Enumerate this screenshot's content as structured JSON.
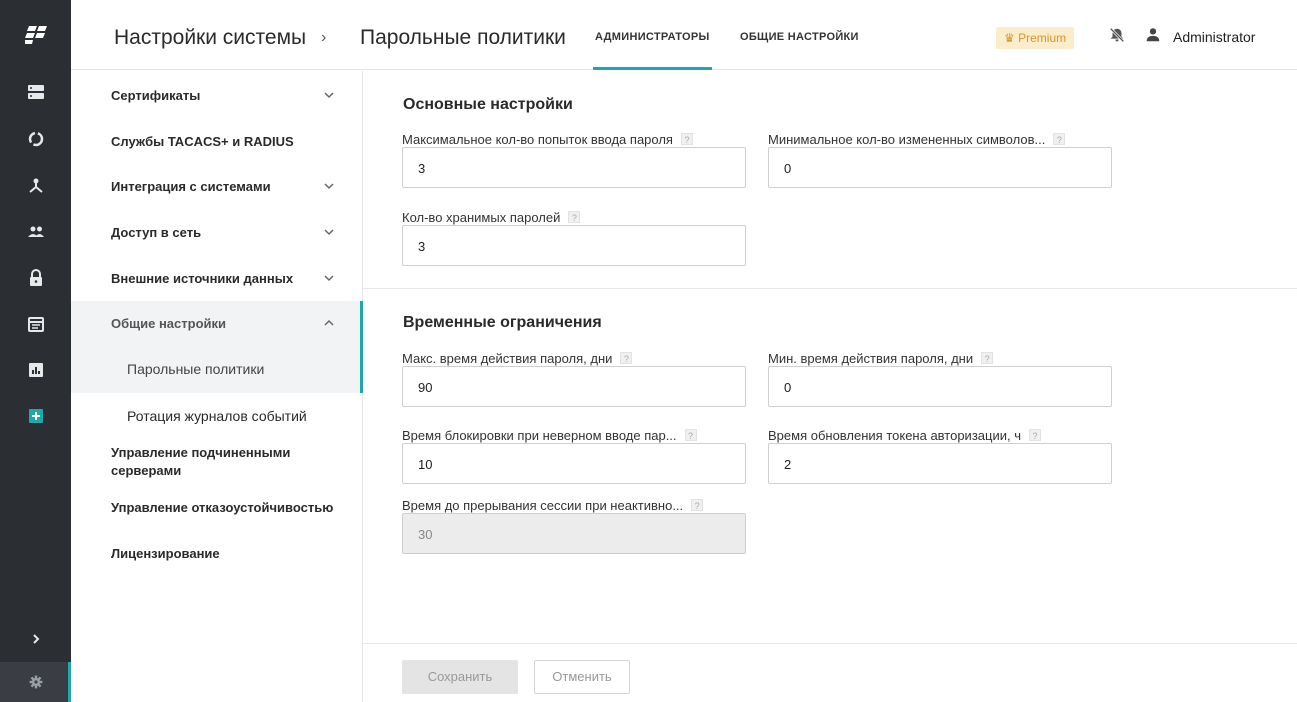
{
  "rail": {
    "icons": [
      "servers-icon",
      "circle-icon",
      "network-icon",
      "users-icon",
      "lock-icon",
      "calendar-icon",
      "report-icon",
      "add-icon"
    ],
    "expand_icon": "chevron-right-icon",
    "settings_icon": "gear-icon",
    "accent_color": "#1fa8a8"
  },
  "header": {
    "breadcrumb_root": "Настройки системы",
    "breadcrumb_sep": "›",
    "breadcrumb_current": "Парольные политики",
    "tabs": [
      {
        "label": "АДМИНИСТРАТОРЫ",
        "active": true
      },
      {
        "label": "ОБЩИЕ НАСТРОЙКИ",
        "active": false
      }
    ],
    "premium": "Premium",
    "user": "Administrator"
  },
  "sidebar": {
    "items": [
      {
        "label": "Сертификаты",
        "expandable": true
      },
      {
        "label": "Службы TACACS+ и RADIUS",
        "expandable": false
      },
      {
        "label": "Интеграция с системами",
        "expandable": true
      },
      {
        "label": "Доступ в сеть",
        "expandable": true
      },
      {
        "label": "Внешние источники данных",
        "expandable": true
      },
      {
        "label": "Общие настройки",
        "expandable": true,
        "expanded": true
      },
      {
        "label": "Управление подчиненными серверами"
      },
      {
        "label": "Управление отказоустойчивостью"
      },
      {
        "label": "Лицензирование"
      }
    ],
    "subitems": [
      {
        "label": "Парольные политики",
        "active": true
      },
      {
        "label": "Ротация журналов событий",
        "active": false
      }
    ]
  },
  "main": {
    "basic": {
      "title": "Основные настройки",
      "max_attempts": {
        "label": "Максимальное кол-во попыток ввода пароля",
        "value": "3"
      },
      "min_changed": {
        "label": "Минимальное кол-во измененных символов...",
        "value": "0"
      },
      "stored": {
        "label": "Кол-во хранимых паролей",
        "value": "3"
      }
    },
    "time": {
      "title": "Временные ограничения",
      "max_days": {
        "label": "Макс. время действия пароля, дни",
        "value": "90"
      },
      "min_days": {
        "label": "Мин. время действия пароля, дни",
        "value": "0"
      },
      "lockout": {
        "label": "Время блокировки при неверном вводе пар...",
        "value": "10"
      },
      "token": {
        "label": "Время обновления токена авторизации, ч",
        "value": "2"
      },
      "inactive": {
        "label": "Время до прерывания сессии при неактивно...",
        "value": "30"
      }
    },
    "help_mark": "?",
    "save": "Сохранить",
    "cancel": "Отменить"
  }
}
